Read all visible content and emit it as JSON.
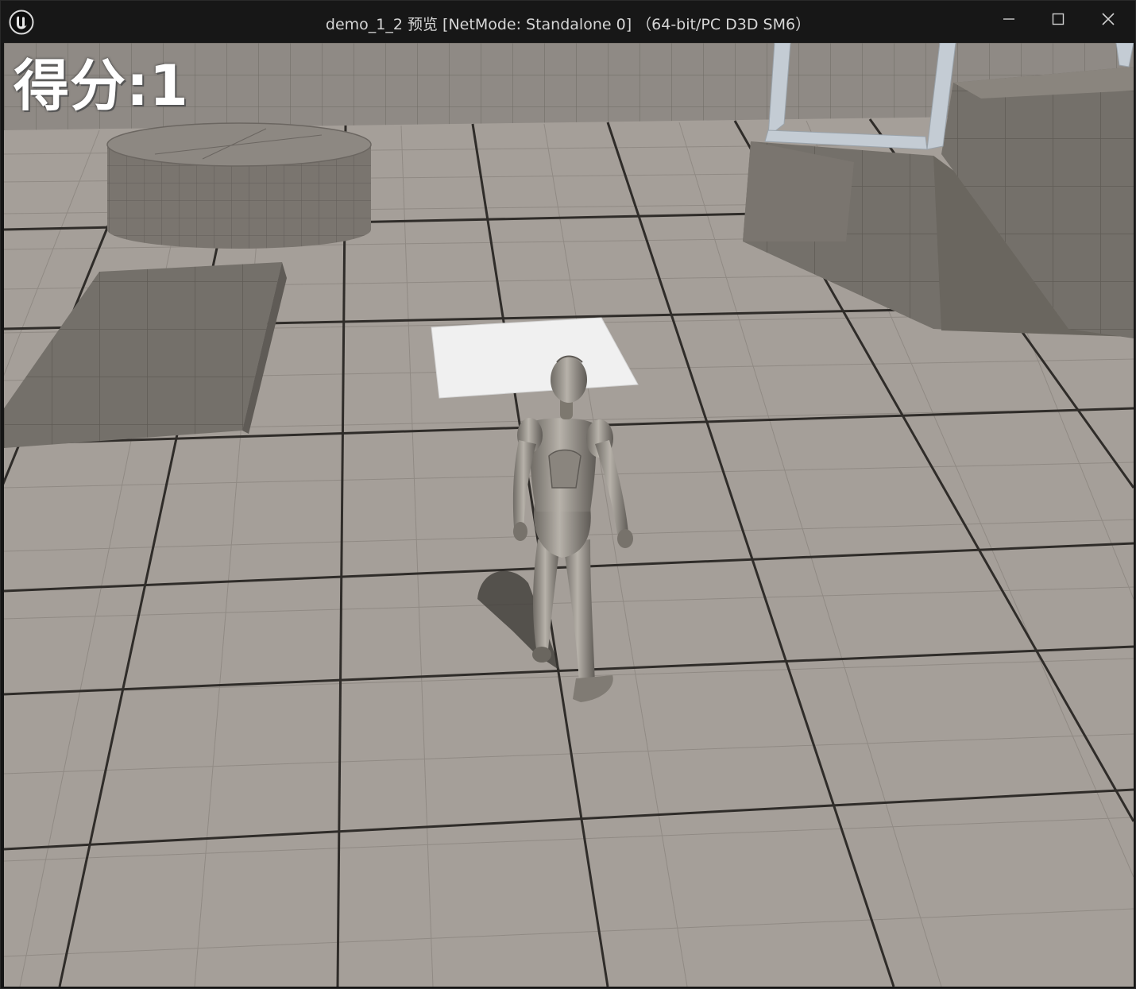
{
  "window": {
    "title": "demo_1_2 预览 [NetMode: Standalone 0] （64-bit/PC D3D SM6）",
    "logo_icon": "unreal-engine-logo-icon",
    "controls": {
      "minimize_icon": "minimize-icon",
      "maximize_icon": "maximize-icon",
      "close_icon": "close-icon"
    }
  },
  "hud": {
    "score_label": "得分",
    "score_separator": ":",
    "score_value": "1"
  },
  "colors": {
    "floor": "#a59f99",
    "floor_grid": "#3a3733",
    "wall": "#8f8a85",
    "block": "#76716b",
    "pickup_tile": "#f0f0f0",
    "character": "#9a958d",
    "frame": "#c4ccd4"
  }
}
